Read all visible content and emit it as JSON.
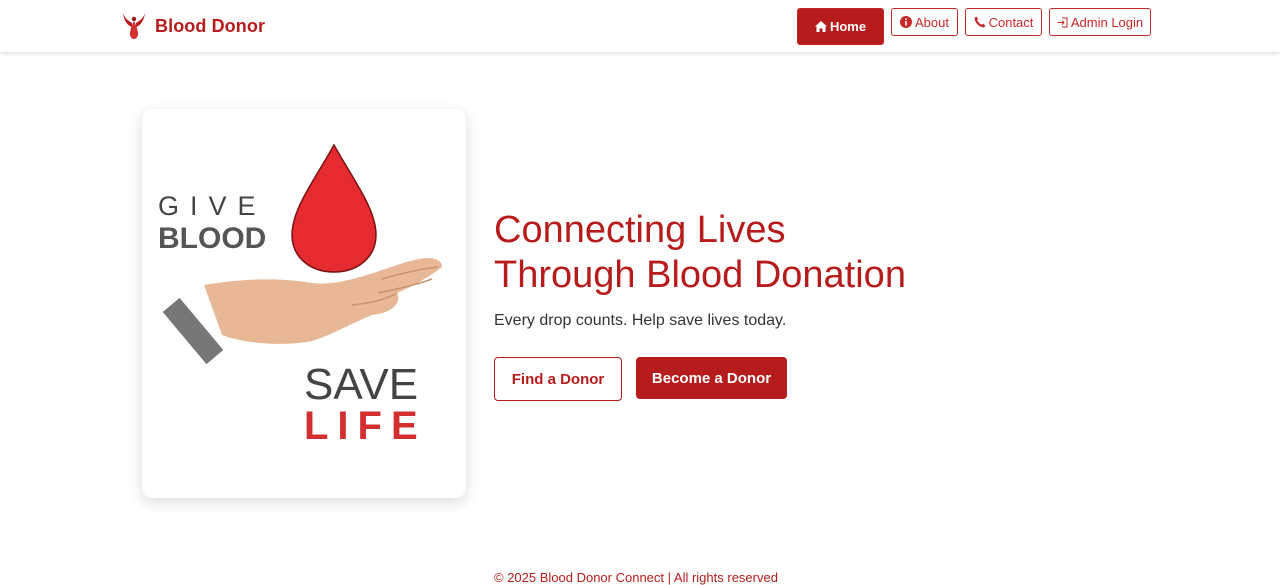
{
  "brand": {
    "name": "Blood Donor",
    "logo_icon": "blood-donor-logo-icon",
    "color": "#b71c1c"
  },
  "nav": {
    "home": {
      "label": "Home",
      "icon": "home-icon"
    },
    "about": {
      "label": "About",
      "icon": "info-icon"
    },
    "contact": {
      "label": "Contact",
      "icon": "phone-icon"
    },
    "admin": {
      "label": "Admin Login",
      "icon": "login-icon"
    }
  },
  "hero": {
    "image_text": {
      "give": "GIVE",
      "blood": "BLOOD",
      "save": "SAVE",
      "life": "LIFE"
    },
    "title_line1": "Connecting Lives",
    "title_line2": "Through Blood Donation",
    "subtitle": "Every drop counts. Help save lives today.",
    "find_button": "Find a Donor",
    "become_button": "Become a Donor"
  },
  "footer": {
    "text": "© 2025 Blood Donor Connect | All rights reserved"
  },
  "colors": {
    "primary": "#b71c1c",
    "drop": "#e52b2f",
    "text_dark": "#333333"
  }
}
